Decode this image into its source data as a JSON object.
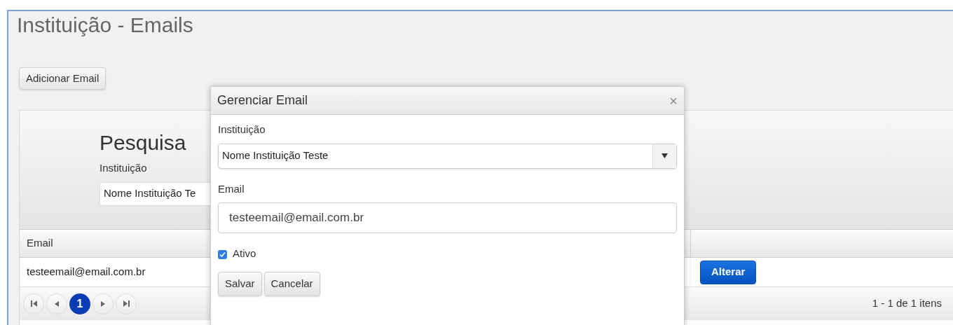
{
  "page": {
    "title": "Instituição - Emails",
    "add_button": "Adicionar Email"
  },
  "search": {
    "title": "Pesquisa",
    "label": "Instituição",
    "value": "Nome Instituição Te"
  },
  "table": {
    "columns": [
      "Email"
    ],
    "rows": [
      {
        "email": "testeemail@email.com.br",
        "action": "Alterar"
      }
    ]
  },
  "pager": {
    "pages": [
      {
        "label": "1",
        "selected": true
      }
    ],
    "summary": "1 - 1 de 1 itens"
  },
  "dialog": {
    "title": "Gerenciar Email",
    "close": "×",
    "fields": [
      {
        "kind": "select",
        "label": "Instituição",
        "value": "Nome Instituição Teste"
      },
      {
        "kind": "text",
        "label": "Email",
        "value": "testeemail@email.com.br"
      },
      {
        "kind": "checkbox",
        "label": "Ativo",
        "checked": true
      }
    ],
    "buttons": [
      "Salvar",
      "Cancelar"
    ]
  }
}
